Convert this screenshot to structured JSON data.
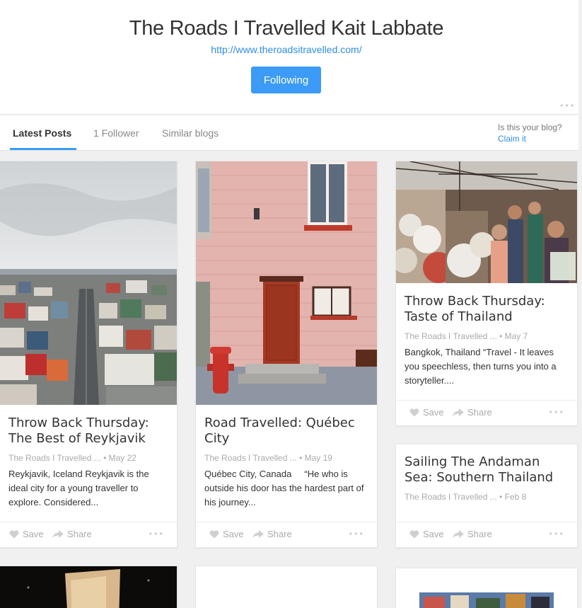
{
  "header": {
    "title": "The Roads I Travelled Kait Labbate",
    "url": "http://www.theroadsitravelled.com/",
    "follow_label": "Following"
  },
  "tabs": [
    {
      "label": "Latest Posts"
    },
    {
      "label": "1 Follower"
    },
    {
      "label": "Similar blogs"
    }
  ],
  "claim": {
    "question": "Is this your blog?",
    "link": "Claim it"
  },
  "actions": {
    "save": "Save",
    "share": "Share",
    "more": "•••"
  },
  "posts": [
    {
      "title": "Throw Back Thursday: The Best of Reykjavik",
      "source": "The Roads I Travelled ...",
      "date": "May 22",
      "excerpt": "Reykjavik, Iceland Reykjavik is the ideal city for a young traveller to explore. Considered..."
    },
    {
      "title": "Road Travelled: Québec City",
      "source": "The Roads I Travelled ...",
      "date": "May 19",
      "excerpt": "Québec City, Canada     “He who is outside his door has the hardest part of his journey..."
    },
    {
      "title": "Throw Back Thursday: Taste of Thailand",
      "source": "The Roads I Travelled ...",
      "date": "May 7",
      "excerpt": "Bangkok, Thailand “Travel - It leaves you speechless, then turns you into a storyteller...."
    },
    {
      "title": "Sailing The Andaman Sea: Southern Thailand",
      "source": "The Roads I Travelled ...",
      "date": "Feb 8"
    }
  ]
}
